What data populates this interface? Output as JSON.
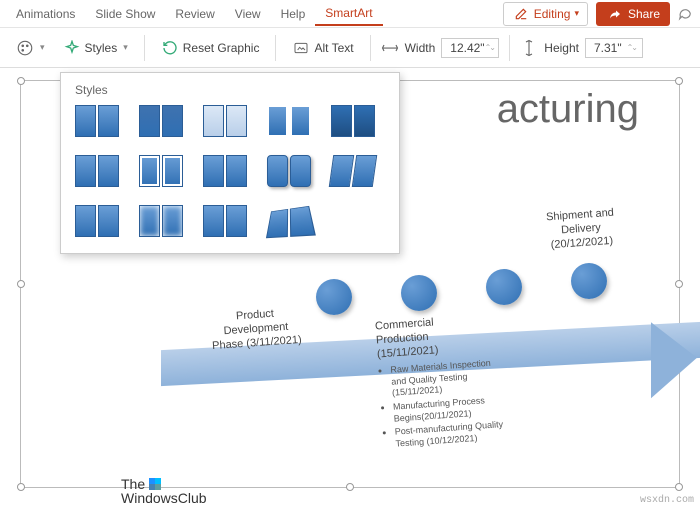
{
  "tabs": {
    "animations": "Animations",
    "slideshow": "Slide Show",
    "review": "Review",
    "view": "View",
    "help": "Help",
    "smartart": "SmartArt"
  },
  "actions": {
    "editing": "Editing",
    "share": "Share"
  },
  "ribbon": {
    "styles": "Styles",
    "reset_graphic": "Reset Graphic",
    "alt_text": "Alt Text",
    "width_label": "Width",
    "width_value": "12.42\"",
    "height_label": "Height",
    "height_value": "7.31\""
  },
  "gallery": {
    "title": "Styles"
  },
  "slide": {
    "partial_title": "acturing",
    "items": {
      "dev": {
        "line1": "Product",
        "line2": "Development",
        "line3": "Phase (3/11/2021)"
      },
      "com": {
        "line1": "Commercial",
        "line2": "Production",
        "line3": "(15/11/2021)"
      },
      "ship": {
        "line1": "Shipment and",
        "line2": "Delivery",
        "line3": "(20/12/2021)"
      }
    },
    "details": {
      "b1": "Raw Materials Inspection and Quality Testing (15/11/2021)",
      "b2": "Manufacturing Process Begins(20/11/2021)",
      "b3": "Post-manufacturing Quality Testing (10/12/2021)"
    },
    "logo1": "The",
    "logo2": "WindowsClub"
  },
  "watermark": "wsxdn.com"
}
